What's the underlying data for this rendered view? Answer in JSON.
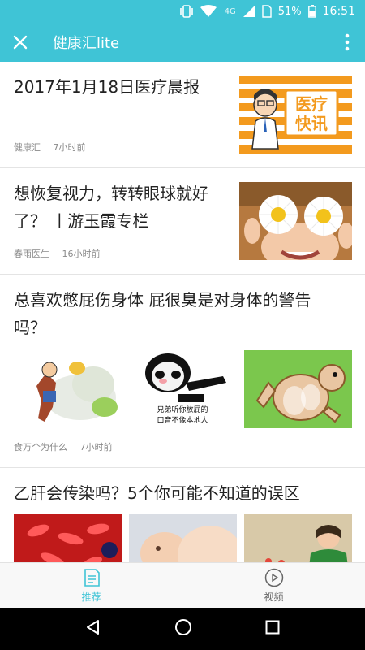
{
  "status_bar": {
    "network": "4G",
    "battery": "51%",
    "time": "16:51"
  },
  "header": {
    "title": "健康汇lite"
  },
  "articles": [
    {
      "title": "2017年1月18日医疗晨报",
      "source": "健康汇",
      "time": "7小时前",
      "thumb_text_1": "医疗",
      "thumb_text_2": "快讯"
    },
    {
      "title_line1": "想恢复视力，转转眼球就好",
      "title_line2": "了？ 丨游玉霞专栏",
      "source": "春雨医生",
      "time": "16小时前"
    },
    {
      "title_line1": "总喜欢憋屁伤身体 屁很臭是对身体的警告",
      "title_line2": "吗？",
      "source": "食万个为什么",
      "time": "7小时前",
      "meme_caption_1": "兄弟听你放屁的",
      "meme_caption_2": "口音不像本地人"
    },
    {
      "title": "乙肝会传染吗？5个你可能不知道的误区"
    }
  ],
  "bottom_nav": [
    {
      "label": "推荐",
      "icon": "document-icon",
      "active": true
    },
    {
      "label": "视频",
      "icon": "play-icon",
      "active": false
    }
  ],
  "colors": {
    "accent": "#3fc4d6",
    "thumb_orange": "#f39a1e"
  }
}
